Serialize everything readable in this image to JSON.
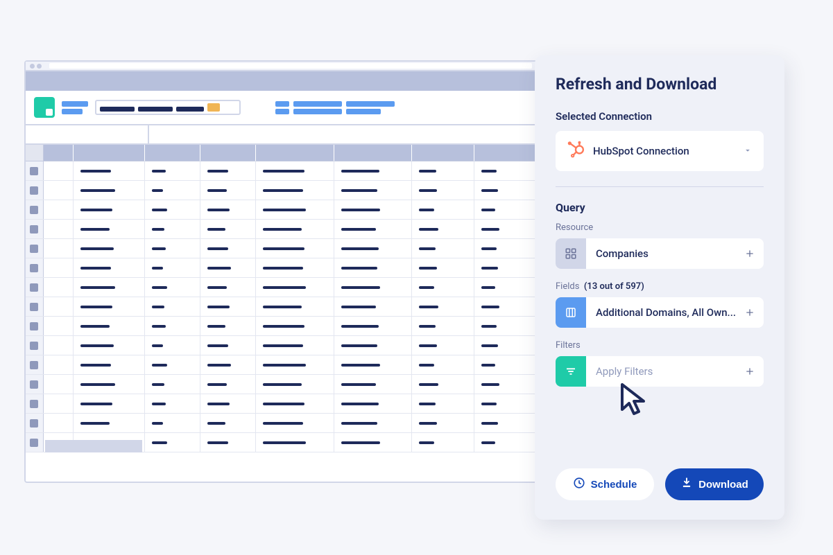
{
  "panel": {
    "title": "Refresh and Download",
    "connection_section": "Selected Connection",
    "connection_name": "HubSpot Connection",
    "query_heading": "Query",
    "resource": {
      "label": "Resource",
      "value": "Companies"
    },
    "fields": {
      "label": "Fields",
      "count_text": "(13 out of 597)",
      "value": "Additional Domains, All Own..."
    },
    "filters": {
      "label": "Filters",
      "placeholder": "Apply Filters"
    },
    "actions": {
      "schedule": "Schedule",
      "download": "Download"
    }
  },
  "spreadsheet": {
    "columns": 7,
    "rows": 15
  }
}
